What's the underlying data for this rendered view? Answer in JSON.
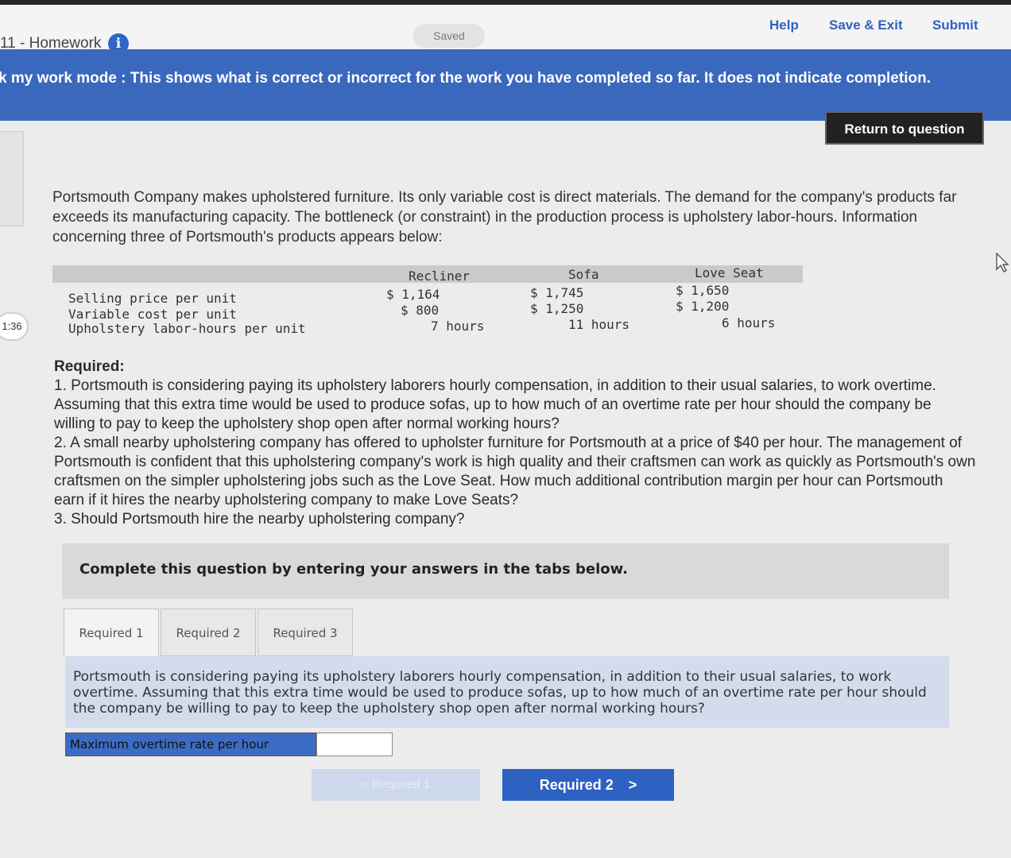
{
  "header": {
    "assignment_title": "11 - Homework",
    "info_icon": "i",
    "saved_status": "Saved",
    "help_label": "Help",
    "save_exit_label": "Save & Exit",
    "submit_label": "Submit"
  },
  "banner": {
    "text": "k my work mode : This shows what is correct or incorrect for the work you have completed so far. It does not indicate completion."
  },
  "return_button": "Return to question",
  "timer_text": "1:36",
  "intro": "Portsmouth Company makes upholstered furniture. Its only variable cost is direct materials. The demand for the company's products far exceeds its manufacturing capacity. The bottleneck (or constraint) in the production process is upholstery labor-hours. Information concerning three of Portsmouth's products appears below:",
  "product_table": {
    "columns": [
      "Recliner",
      "Sofa",
      "Love Seat"
    ],
    "rows": [
      {
        "label": "Selling price per unit",
        "values": [
          "$ 1,164",
          "$ 1,745",
          "$ 1,650"
        ]
      },
      {
        "label": "Variable cost per unit",
        "values": [
          "$ 800",
          "$ 1,250",
          "$ 1,200"
        ]
      },
      {
        "label": "Upholstery labor-hours per unit",
        "values": [
          "7 hours",
          "11 hours",
          "6 hours"
        ]
      }
    ]
  },
  "required": {
    "heading": "Required:",
    "items": [
      "1. Portsmouth is considering paying its upholstery laborers hourly compensation, in addition to their usual salaries, to work overtime. Assuming that this extra time would be used to produce sofas, up to how much of an overtime rate per hour should the company be willing to pay to keep the upholstery shop open after normal working hours?",
      "2. A small nearby upholstering company has offered to upholster furniture for Portsmouth at a price of $40 per hour. The management of Portsmouth is confident that this upholstering company's work is high quality and their craftsmen can work as quickly as Portsmouth's own craftsmen on the simpler upholstering jobs such as the Love Seat. How much additional contribution margin per hour can Portsmouth earn if it hires the nearby upholstering company to make Love Seats?",
      "3. Should Portsmouth hire the nearby upholstering company?"
    ]
  },
  "instruction": "Complete this question by entering your answers in the tabs below.",
  "tabs": [
    "Required 1",
    "Required 2",
    "Required 3"
  ],
  "active_tab": "Required 1",
  "question_text": "Portsmouth is considering paying its upholstery laborers hourly compensation, in addition to their usual salaries, to work overtime. Assuming that this extra time would be used to produce sofas, up to how much of an overtime rate per hour should the company be willing to pay to keep the upholstery shop open after normal working hours?",
  "answer": {
    "label": "Maximum overtime rate per hour",
    "value": ""
  },
  "nav": {
    "prev_label": "< Required 1",
    "next_label": "Required 2",
    "next_arrow": ">"
  },
  "colors": {
    "accent_blue": "#3a68bd",
    "button_blue": "#2e62c2",
    "panel_blue": "#d3dced"
  }
}
